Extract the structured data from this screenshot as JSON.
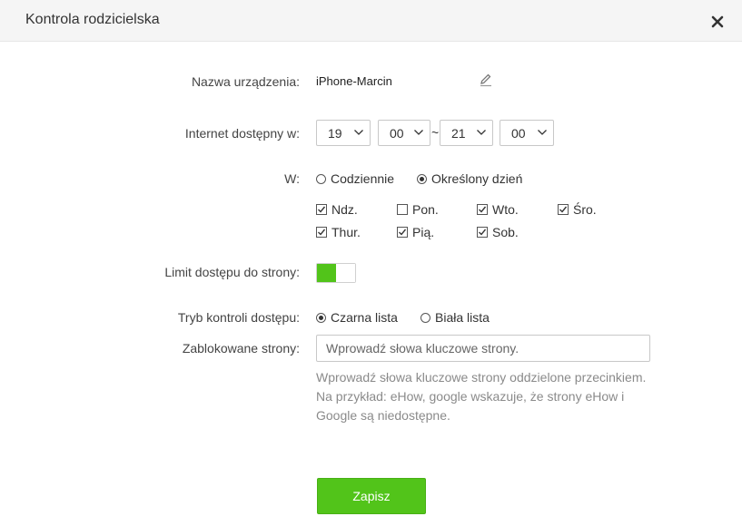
{
  "dialog": {
    "title": "Kontrola rodzicielska"
  },
  "device": {
    "label": "Nazwa urządzenia:",
    "name": "iPhone-Marcin"
  },
  "internet": {
    "label": "Internet dostępny w:",
    "start_hour": "19",
    "start_minute": "00",
    "separator": "~",
    "end_hour": "21",
    "end_minute": "00"
  },
  "days": {
    "label": "W:",
    "mode_daily": "Codziennie",
    "mode_specific": "Określony dzień",
    "selected_mode": "specific",
    "items": [
      {
        "label": "Ndz.",
        "checked": true
      },
      {
        "label": "Pon.",
        "checked": false
      },
      {
        "label": "Wto.",
        "checked": true
      },
      {
        "label": "Śro.",
        "checked": true
      },
      {
        "label": "Thur.",
        "checked": true
      },
      {
        "label": "Pią.",
        "checked": true
      },
      {
        "label": "Sob.",
        "checked": true
      }
    ]
  },
  "limit": {
    "label": "Limit dostępu do strony:",
    "enabled": true
  },
  "control_mode": {
    "label": "Tryb kontroli dostępu:",
    "blacklist": "Czarna lista",
    "whitelist": "Biała lista",
    "selected": "blacklist"
  },
  "blocked": {
    "label": "Zablokowane strony:",
    "placeholder": "Wprowadź słowa kluczowe strony.",
    "value": "",
    "hint": "Wprowadź słowa kluczowe strony oddzielone przecinkiem. Na przykład: eHow, google wskazuje, że strony eHow i Google są niedostępne."
  },
  "actions": {
    "save_label": "Zapisz"
  },
  "colors": {
    "accent": "#52c41a",
    "header_bg": "#f5f5f5",
    "hint_text": "#8a8a8a"
  },
  "icons": {
    "close": "close-icon",
    "edit": "pencil-icon",
    "dropdown": "chevron-down-icon"
  }
}
